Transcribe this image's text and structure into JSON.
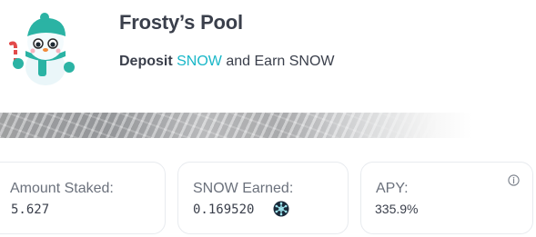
{
  "pool": {
    "title": "Frosty’s Pool",
    "subtitle": {
      "deposit_word": "Deposit",
      "deposit_token": "SNOW",
      "earn_text": " and Earn SNOW"
    },
    "mascot_icon": "snowman-icon"
  },
  "banner": {
    "image": "snowy-mountain-banner"
  },
  "stats": [
    {
      "label": "Amount Staked:",
      "value": "5.627"
    },
    {
      "label": "SNOW Earned:",
      "value": "0.169520",
      "icon": "snow-token-icon"
    },
    {
      "label": "APY:",
      "value": "335.9%",
      "icon": "info-icon"
    }
  ],
  "colors": {
    "accent": "#19b7c8",
    "text": "#3a3f4b",
    "muted": "#6b717c",
    "border": "#e8ebef"
  }
}
